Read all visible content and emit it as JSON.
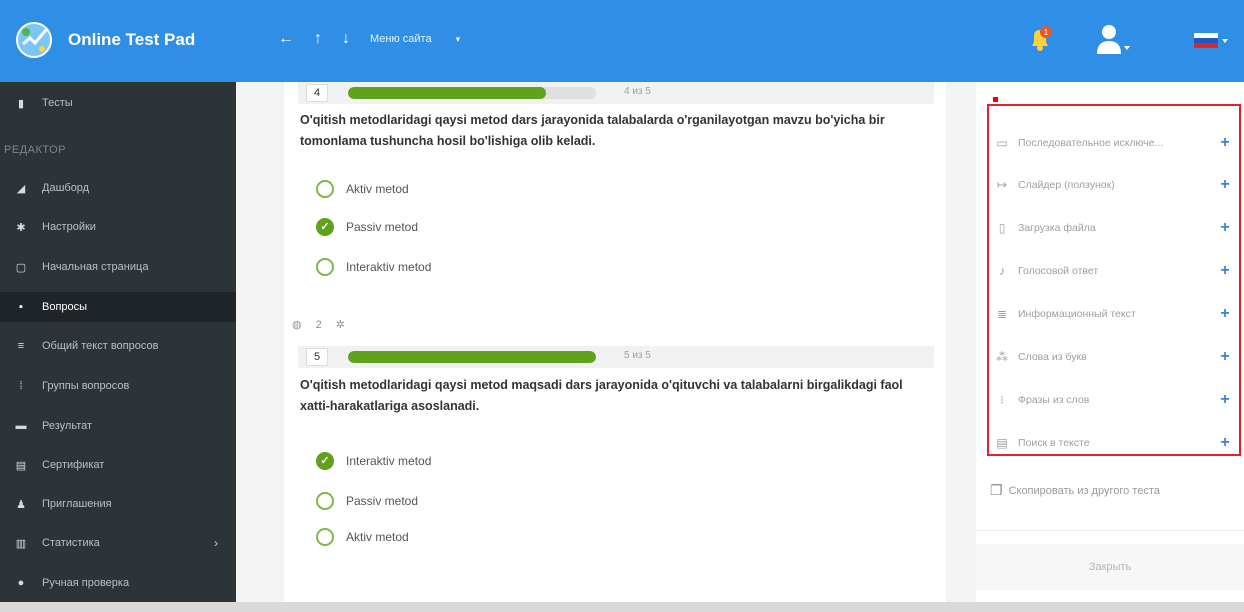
{
  "header": {
    "app_title": "Online Test Pad",
    "nav_back": "←",
    "nav_up": "↑",
    "nav_down": "↓",
    "site_menu_label": "Меню сайта",
    "site_menu_caret": "▾",
    "notification_count": "1"
  },
  "sidebar": {
    "section_label": "РЕДАКТОР",
    "expand_glyph": "›",
    "items": [
      {
        "label": "Тесты",
        "icon": "book-icon",
        "glyph": "▮"
      },
      {
        "label": "Дашборд",
        "icon": "dashboard-icon",
        "glyph": "◢"
      },
      {
        "label": "Настройки",
        "icon": "gear-icon",
        "glyph": "✱"
      },
      {
        "label": "Начальная страница",
        "icon": "page-icon",
        "glyph": "▢"
      },
      {
        "label": "Вопросы",
        "icon": "questions-icon",
        "glyph": "▪"
      },
      {
        "label": "Общий текст вопросов",
        "icon": "text-icon",
        "glyph": "≡"
      },
      {
        "label": "Группы вопросов",
        "icon": "groups-icon",
        "glyph": "⁞"
      },
      {
        "label": "Результат",
        "icon": "result-icon",
        "glyph": "▬"
      },
      {
        "label": "Сертификат",
        "icon": "certificate-icon",
        "glyph": "▤"
      },
      {
        "label": "Приглашения",
        "icon": "invite-icon",
        "glyph": "♟"
      },
      {
        "label": "Статистика",
        "icon": "stats-icon",
        "glyph": "▥"
      },
      {
        "label": "Ручная проверка",
        "icon": "manual-check-icon",
        "glyph": "●"
      }
    ],
    "active_index": 4
  },
  "questions": [
    {
      "number": "4",
      "progress": 0.8,
      "count_text": "4 из 5",
      "text": "O'qitish metodlaridagi qaysi metod dars jarayonida talabalarda o'rganilayotgan mavzu bo'yicha bir tomonlama tushuncha hosil bo'lishiga olib keladi.",
      "options": [
        {
          "label": "Aktiv metod",
          "checked": false
        },
        {
          "label": "Passiv metod",
          "checked": true
        },
        {
          "label": "Interaktiv metod",
          "checked": false
        }
      ]
    },
    {
      "number": "5",
      "progress": 1.0,
      "count_text": "5 из 5",
      "text": "O'qitish metodlaridagi qaysi metod maqsadi dars jarayonida o'qituvchi va talabalarni birgalikdagi faol xatti-harakatlariga asoslanadi.",
      "options": [
        {
          "label": "Interaktiv metod",
          "checked": true
        },
        {
          "label": "Passiv metod",
          "checked": false
        },
        {
          "label": "Aktiv metod",
          "checked": false
        }
      ]
    }
  ],
  "question_tools": {
    "copy_count": "2",
    "copy_glyph": "◍",
    "settings_glyph": "✲"
  },
  "right_panel": {
    "items": [
      {
        "label": "Последовательное исключе...",
        "icon": "sequence-icon",
        "glyph": "▭"
      },
      {
        "label": "Слайдер (ползунок)",
        "icon": "slider-icon",
        "glyph": "↦"
      },
      {
        "label": "Загрузка файла",
        "icon": "file-upload-icon",
        "glyph": "▯"
      },
      {
        "label": "Голосовой ответ",
        "icon": "microphone-icon",
        "glyph": "♪"
      },
      {
        "label": "Информационный текст",
        "icon": "info-text-icon",
        "glyph": "≣"
      },
      {
        "label": "Слова из букв",
        "icon": "letters-icon",
        "glyph": "⁂"
      },
      {
        "label": "Фразы из слов",
        "icon": "words-icon",
        "glyph": "⁝"
      },
      {
        "label": "Поиск в тексте",
        "icon": "search-text-icon",
        "glyph": "▤"
      }
    ],
    "plus_glyph": "+",
    "copy_from_test": "Скопировать из другого теста",
    "copy_glyph": "❐",
    "close_label": "Закрыть"
  },
  "colors": {
    "topbar": "#2f8fe6",
    "sidebar": "#2d3438",
    "progress": "#5fa31d",
    "highlight": "#e4222a"
  }
}
